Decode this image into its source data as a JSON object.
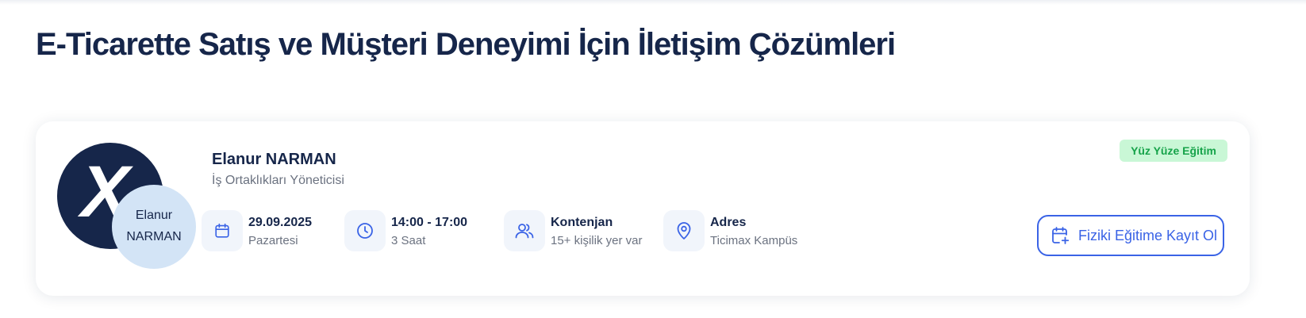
{
  "page": {
    "title": "E-Ticarette Satış ve Müşteri Deneyimi İçin İletişim Çözümleri"
  },
  "card": {
    "avatar": {
      "logo_letter": "X",
      "name_line1": "Elanur",
      "name_line2": "NARMAN"
    },
    "speaker": {
      "name": "Elanur NARMAN",
      "role": "İş Ortaklıkları Yöneticisi"
    },
    "info": [
      {
        "icon": "calendar-icon",
        "title": "29.09.2025",
        "subtitle": "Pazartesi"
      },
      {
        "icon": "clock-icon",
        "title": "14:00 - 17:00",
        "subtitle": "3 Saat"
      },
      {
        "icon": "users-icon",
        "title": "Kontenjan",
        "subtitle": "15+ kişilik yer var"
      },
      {
        "icon": "location-pin-icon",
        "title": "Adres",
        "subtitle": "Ticimax Kampüs"
      }
    ],
    "badge": "Yüz Yüze Eğitim",
    "register_button": {
      "icon": "calendar-plus-icon",
      "label": "Fiziki Eğitime Kayıt Ol"
    }
  },
  "colors": {
    "primary_dark": "#16264a",
    "accent_blue": "#3a63e6",
    "badge_bg": "#c9f7d6",
    "badge_text": "#16a34a",
    "avatar_light": "#d3e4f6"
  }
}
